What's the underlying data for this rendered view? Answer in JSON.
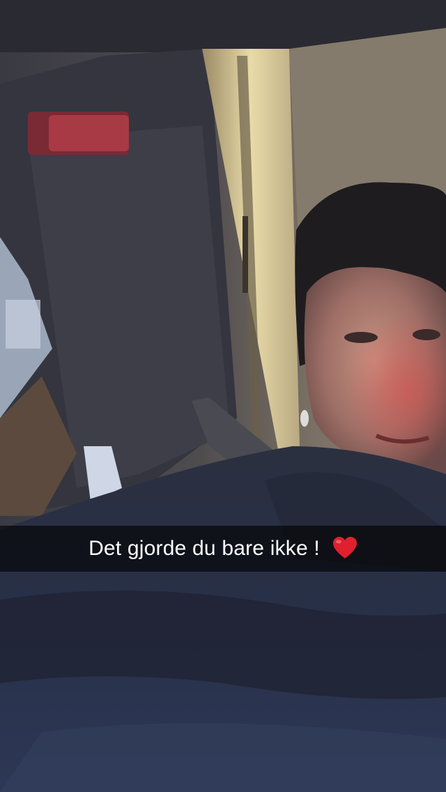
{
  "snap": {
    "caption": {
      "text": "Det gjorde du bare ikke !",
      "emoji_icon": "red-heart-icon",
      "emoji_color": "#e0202e"
    }
  }
}
